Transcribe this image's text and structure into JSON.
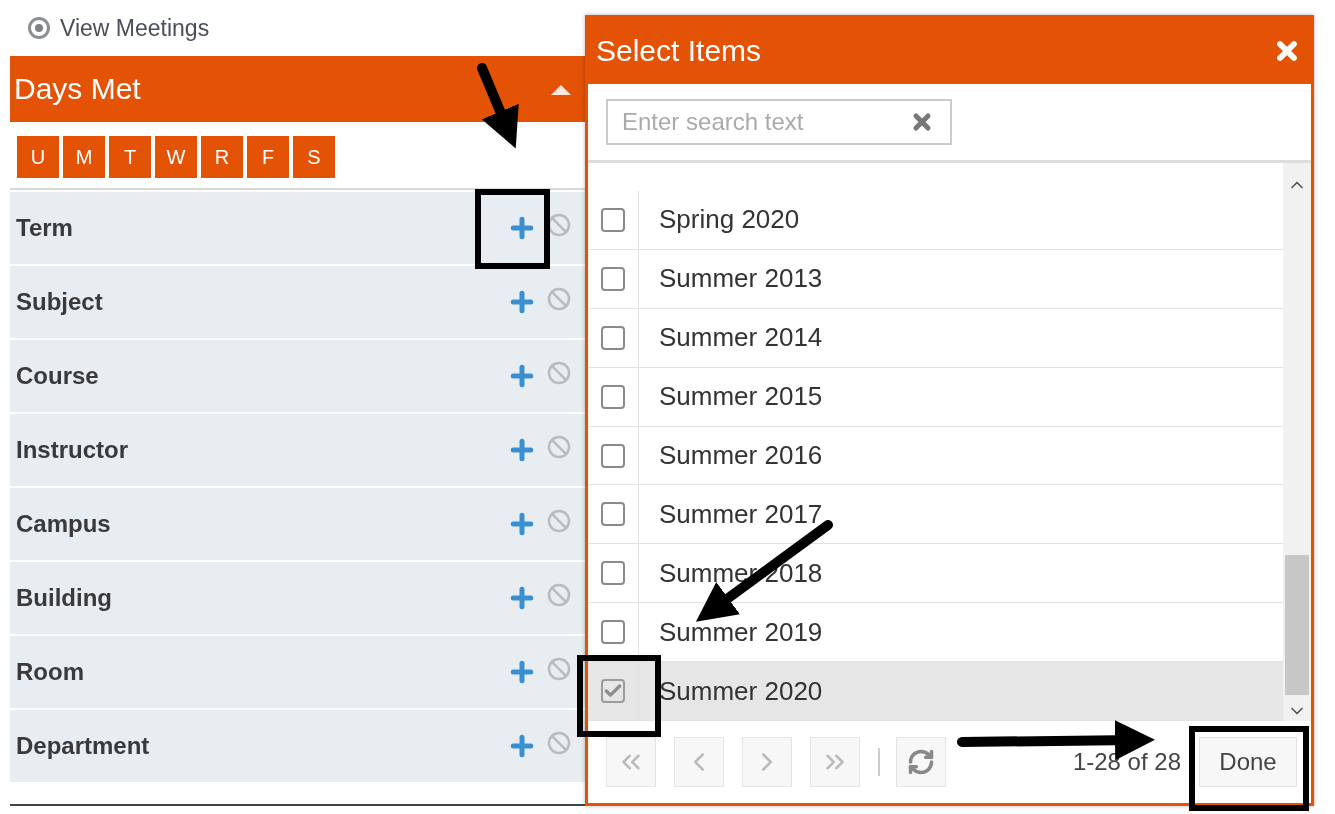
{
  "view_option": {
    "label": "View Meetings",
    "selected": true
  },
  "days_met": {
    "title": "Days Met",
    "expanded": true,
    "days": [
      "U",
      "M",
      "T",
      "W",
      "R",
      "F",
      "S"
    ]
  },
  "filters": [
    {
      "label": "Term"
    },
    {
      "label": "Subject"
    },
    {
      "label": "Course"
    },
    {
      "label": "Instructor"
    },
    {
      "label": "Campus"
    },
    {
      "label": "Building"
    },
    {
      "label": "Room"
    },
    {
      "label": "Department"
    }
  ],
  "dialog": {
    "title": "Select Items",
    "search": {
      "placeholder": "Enter search text"
    },
    "items": [
      {
        "label": "Spring 2020",
        "checked": false
      },
      {
        "label": "Summer 2013",
        "checked": false
      },
      {
        "label": "Summer 2014",
        "checked": false
      },
      {
        "label": "Summer 2015",
        "checked": false
      },
      {
        "label": "Summer 2016",
        "checked": false
      },
      {
        "label": "Summer 2017",
        "checked": false
      },
      {
        "label": "Summer 2018",
        "checked": false
      },
      {
        "label": "Summer 2019",
        "checked": false
      },
      {
        "label": "Summer 2020",
        "checked": true
      }
    ],
    "range": "1-28 of 28",
    "done_button": "Done"
  }
}
